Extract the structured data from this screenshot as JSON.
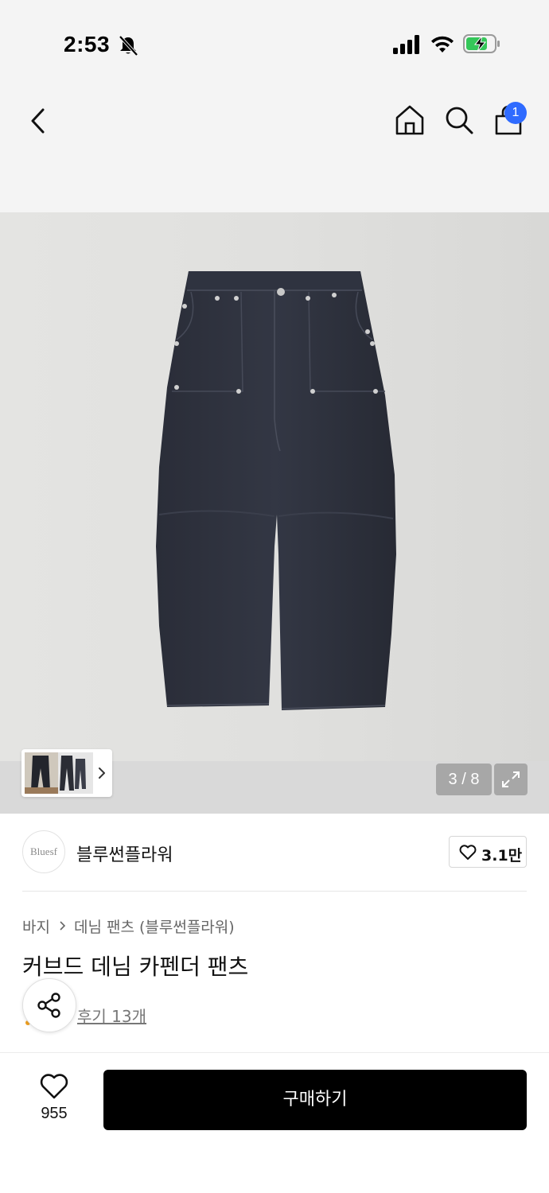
{
  "status_bar": {
    "time": "2:53",
    "icons": [
      "bell-slash-icon",
      "cellular-signal-icon",
      "wifi-icon",
      "battery-charging-icon"
    ]
  },
  "nav": {
    "icons": [
      "back-chevron-icon",
      "home-icon",
      "search-icon",
      "shopping-bag-icon"
    ],
    "cart_badge": "1"
  },
  "gallery": {
    "counter": "3 / 8",
    "icons": [
      "chevron-right-icon",
      "expand-icon"
    ]
  },
  "brand": {
    "logo_text": "Bluesf",
    "name": "블루썬플라워",
    "like_count": "3.1만"
  },
  "product": {
    "breadcrumb": [
      "바지",
      "데님 팬츠 (블루썬플라워)"
    ],
    "title": "커브드 데님 카펜더 팬츠",
    "review_link": "후기 13개"
  },
  "bottom_bar": {
    "like_count": "955",
    "buy_label": "구매하기"
  },
  "colors": {
    "badge": "#2f6bff",
    "buy_button": "#000000",
    "denim": "#2c2f3b",
    "background": "#f4f4f4"
  }
}
